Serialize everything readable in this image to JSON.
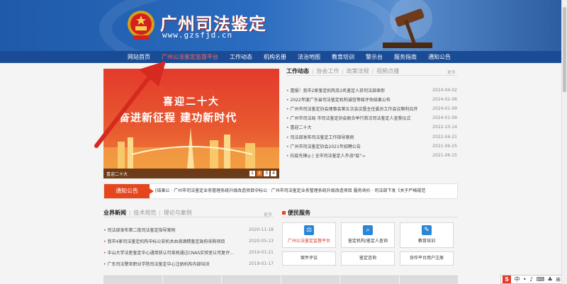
{
  "header": {
    "site_name": "广州司法鉴定",
    "site_url": "www.gzsfjd.cn"
  },
  "nav": {
    "items": [
      {
        "label": "网站首页",
        "active": false
      },
      {
        "label": "广州公法鉴定监督平台",
        "active": true
      },
      {
        "label": "工作动态",
        "active": false
      },
      {
        "label": "机构名册",
        "active": false
      },
      {
        "label": "法治地图",
        "active": false
      },
      {
        "label": "教育培训",
        "active": false
      },
      {
        "label": "警示台",
        "active": false
      },
      {
        "label": "服务指南",
        "active": false
      },
      {
        "label": "通知公告",
        "active": false
      }
    ]
  },
  "carousel": {
    "headline1": "喜迎二十大",
    "headline2": "奋进新征程  建功新时代",
    "caption": "喜迎二十大",
    "pages": [
      "1",
      "2",
      "3",
      "4"
    ],
    "active_page": "2"
  },
  "work_panel": {
    "tabs": [
      {
        "label": "工作动态",
        "active": true
      },
      {
        "label": "协会工作",
        "active": false
      },
      {
        "label": "政策法规",
        "active": false
      },
      {
        "label": "视频点播",
        "active": false
      }
    ],
    "more": "更多",
    "items": [
      {
        "title": "喜报！我市2家鉴定机构及2名鉴定人获司法部表彰",
        "date": "2024-04-02"
      },
      {
        "title": "2022年度广东省司法鉴定机构诚信等级评估结果公布",
        "date": "2024-02-06"
      },
      {
        "title": "广州市司法鉴定协会理事会第五次会议暨主任委员工作会议顺利召开",
        "date": "2024-01-09"
      },
      {
        "title": "广州市司法局 市司法鉴定协会联合举行首次司法鉴定人宣誓仪式",
        "date": "2024-01-09"
      },
      {
        "title": "喜迎二十大",
        "date": "2022-10-14"
      },
      {
        "title": "司法部发布司法鉴定工作指导案例",
        "date": "2022-04-21"
      },
      {
        "title": "广州市司法鉴定协会2021年招聘公告",
        "date": "2021-06-25"
      },
      {
        "title": "抗疫先锋◎ | 全市司法鉴定人齐战\"疫\"→",
        "date": "2021-06-15"
      }
    ]
  },
  "notice": {
    "label": "通知公告",
    "text": "[结果公 · 广州市司法鉴定业务管理系统升级改造项目中标公 · 广州市司法鉴定业务管理系统升级改造项目 服务询价 · 司法部下发《关于严格规范"
  },
  "industry": {
    "tabs": [
      {
        "label": "业界新闻",
        "active": true
      },
      {
        "label": "技术规范",
        "active": false
      },
      {
        "label": "理论与案例",
        "active": false
      }
    ],
    "more": "更多",
    "items": [
      {
        "title": "司法部发布第二批司法鉴定指导案例",
        "date": "2020-11-18"
      },
      {
        "title": "我市4家司法鉴定机构中标公安机关血液酒精鉴定政府采购项目",
        "date": "2020-05-13"
      },
      {
        "title": "中山大学法医鉴定中心通用获认可准则通过CNAS实验室认可复评...",
        "date": "2019-01-21"
      },
      {
        "title": "广东司法警官职业学院司法鉴定中心注册机构内部培训",
        "date": "2019-01-17"
      }
    ]
  },
  "services": {
    "title": "便民服务",
    "cards": [
      {
        "label": "广州公法鉴定监督平台",
        "icon": "platform-icon",
        "highlight": true
      },
      {
        "label": "鉴定机构/鉴定人查询",
        "icon": "search-person-icon",
        "highlight": false
      },
      {
        "label": "教育培训",
        "icon": "education-icon",
        "highlight": false
      },
      {
        "label": "案件评议",
        "icon": "review-icon",
        "highlight": false
      },
      {
        "label": "鉴定咨询",
        "icon": "consult-icon",
        "highlight": false
      },
      {
        "label": "协作平台用户注册",
        "icon": "register-icon",
        "highlight": false
      }
    ]
  },
  "ime": {
    "items": [
      "S",
      "中",
      "•",
      "♪",
      "⌨",
      "♣",
      "⊞"
    ]
  },
  "colors": {
    "nav_bg": "#1a4c96",
    "accent_red": "#e5461d",
    "arrow_red": "#d6291f"
  }
}
